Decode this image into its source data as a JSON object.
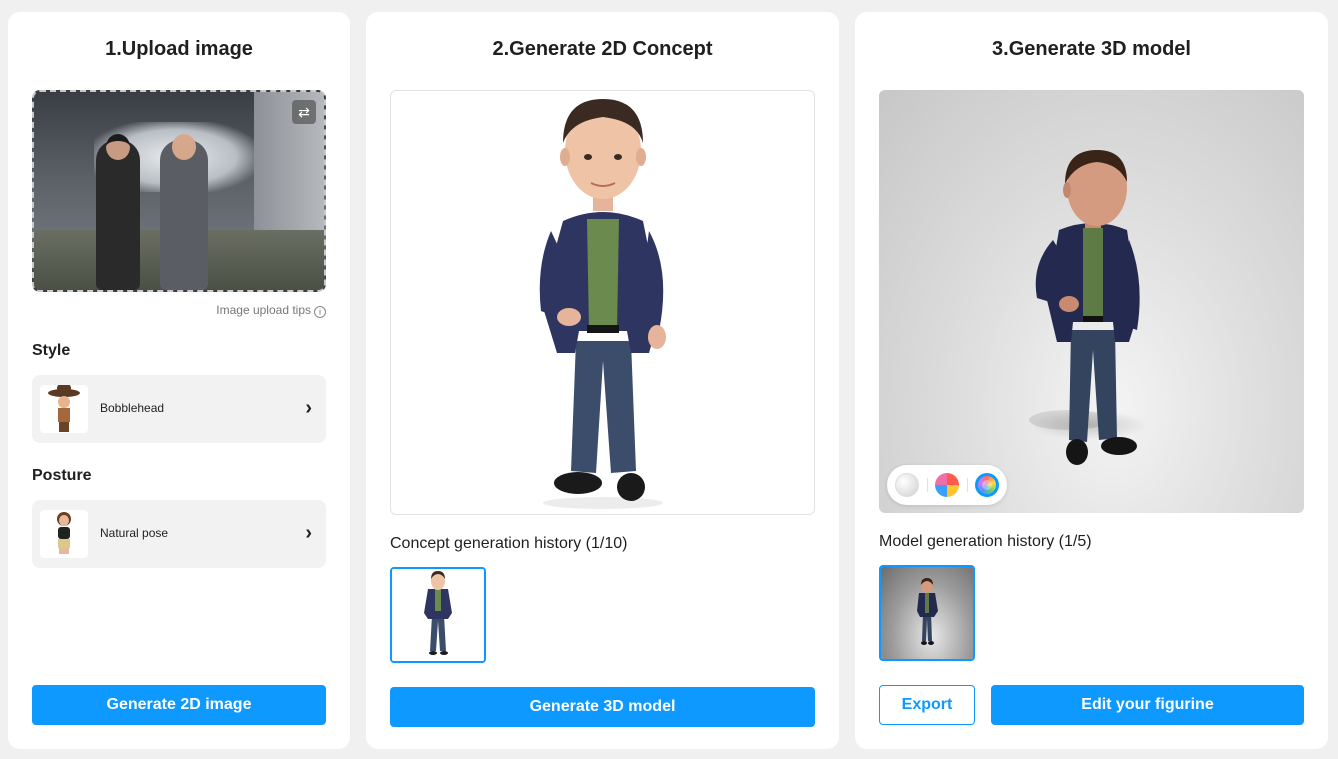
{
  "panel1": {
    "title": "1.Upload image",
    "upload_tips": "Image upload tips",
    "style_label": "Style",
    "style_value": "Bobblehead",
    "posture_label": "Posture",
    "posture_value": "Natural pose",
    "generate_button": "Generate 2D image"
  },
  "panel2": {
    "title": "2.Generate 2D Concept",
    "history_label": "Concept generation history (1/10)",
    "generate_button": "Generate 3D model"
  },
  "panel3": {
    "title": "3.Generate 3D model",
    "history_label": "Model generation history (1/5)",
    "export_button": "Export",
    "edit_button": "Edit your figurine"
  },
  "icons": {
    "swap": "swap-icon",
    "info": "info-icon",
    "chevron": "chevron-right-icon"
  },
  "colors": {
    "accent": "#0d99ff",
    "background": "#f0f0f0",
    "panel": "#ffffff"
  }
}
